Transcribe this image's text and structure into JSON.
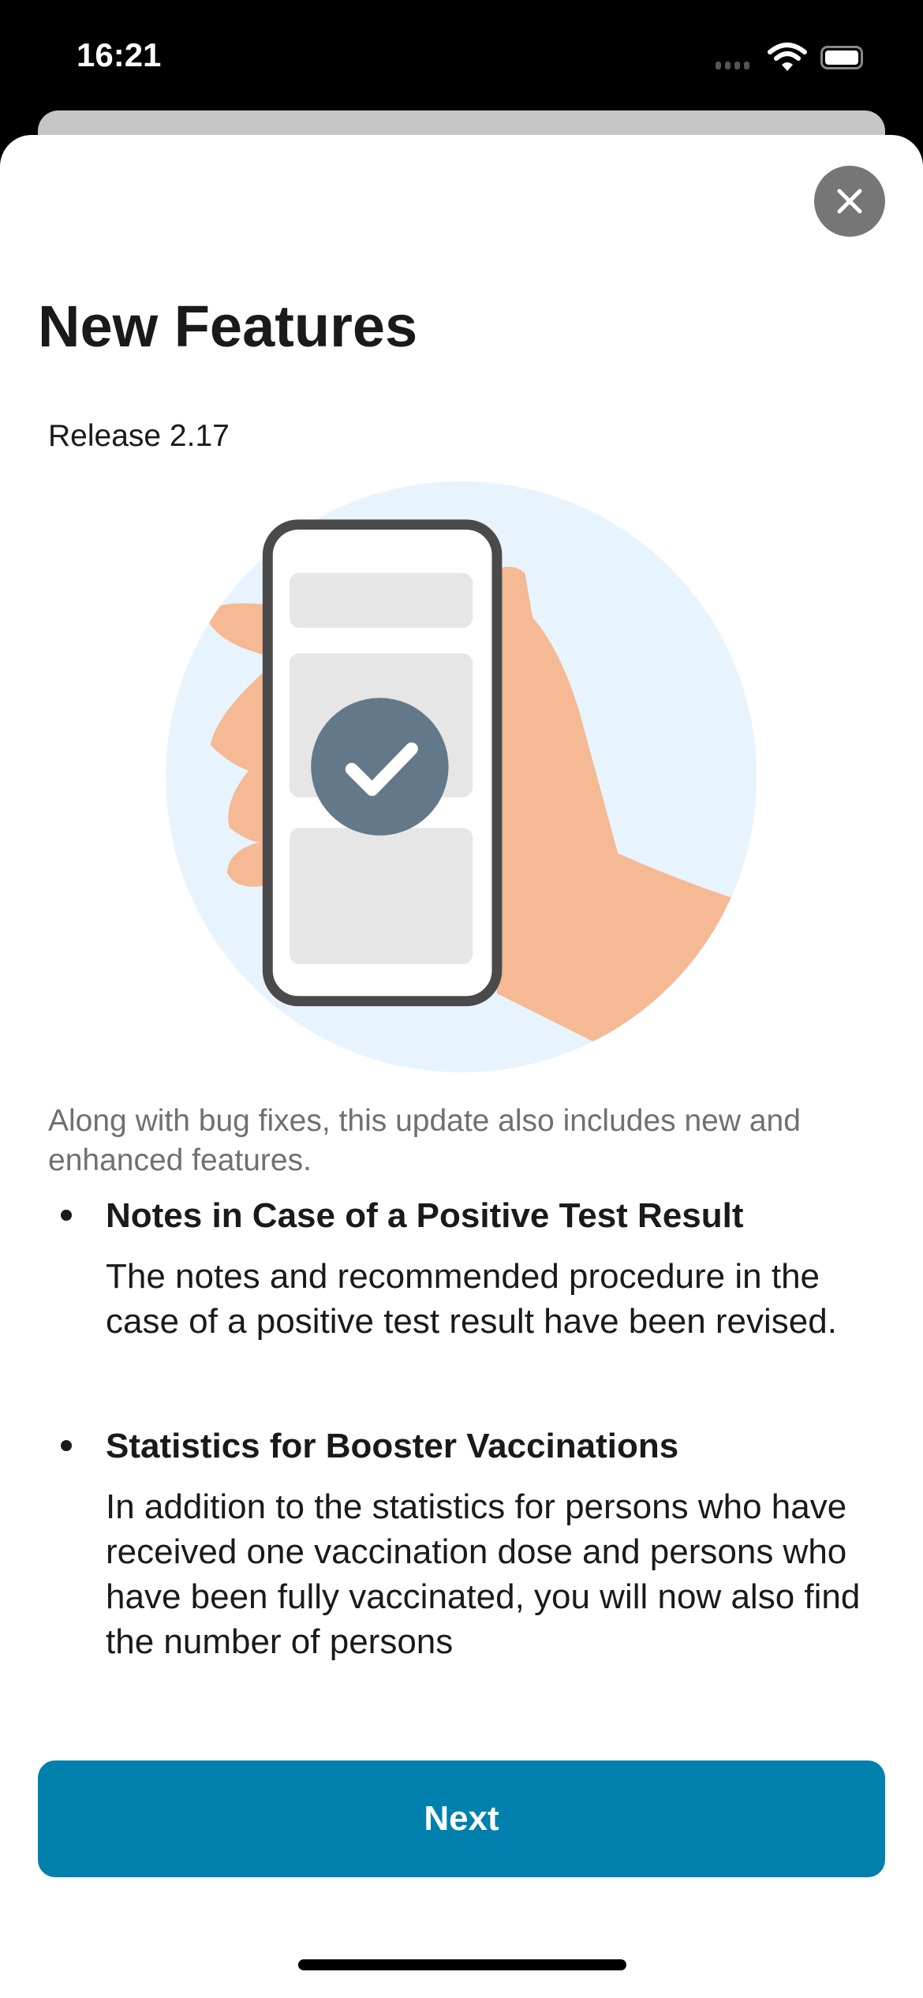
{
  "status_bar": {
    "time": "16:21"
  },
  "sheet": {
    "title": "New Features",
    "release": "Release 2.17",
    "description": "Along with bug fixes, this update also includes new and enhanced features.",
    "features": [
      {
        "heading": "Notes in Case of a Positive Test Result",
        "body": "The notes and recommended procedure in the case of a positive test result have been revised."
      },
      {
        "heading": "Statistics for Booster Vaccinations",
        "body": "In addition to the statistics for persons who have received one vaccination dose and persons who have been fully vaccinated, you will now also find the number of persons"
      }
    ],
    "next_label": "Next"
  },
  "colors": {
    "accent": "#0080ad",
    "close_bg": "#767676",
    "circle": "#e8f4fd",
    "skin": "#f5b994"
  }
}
